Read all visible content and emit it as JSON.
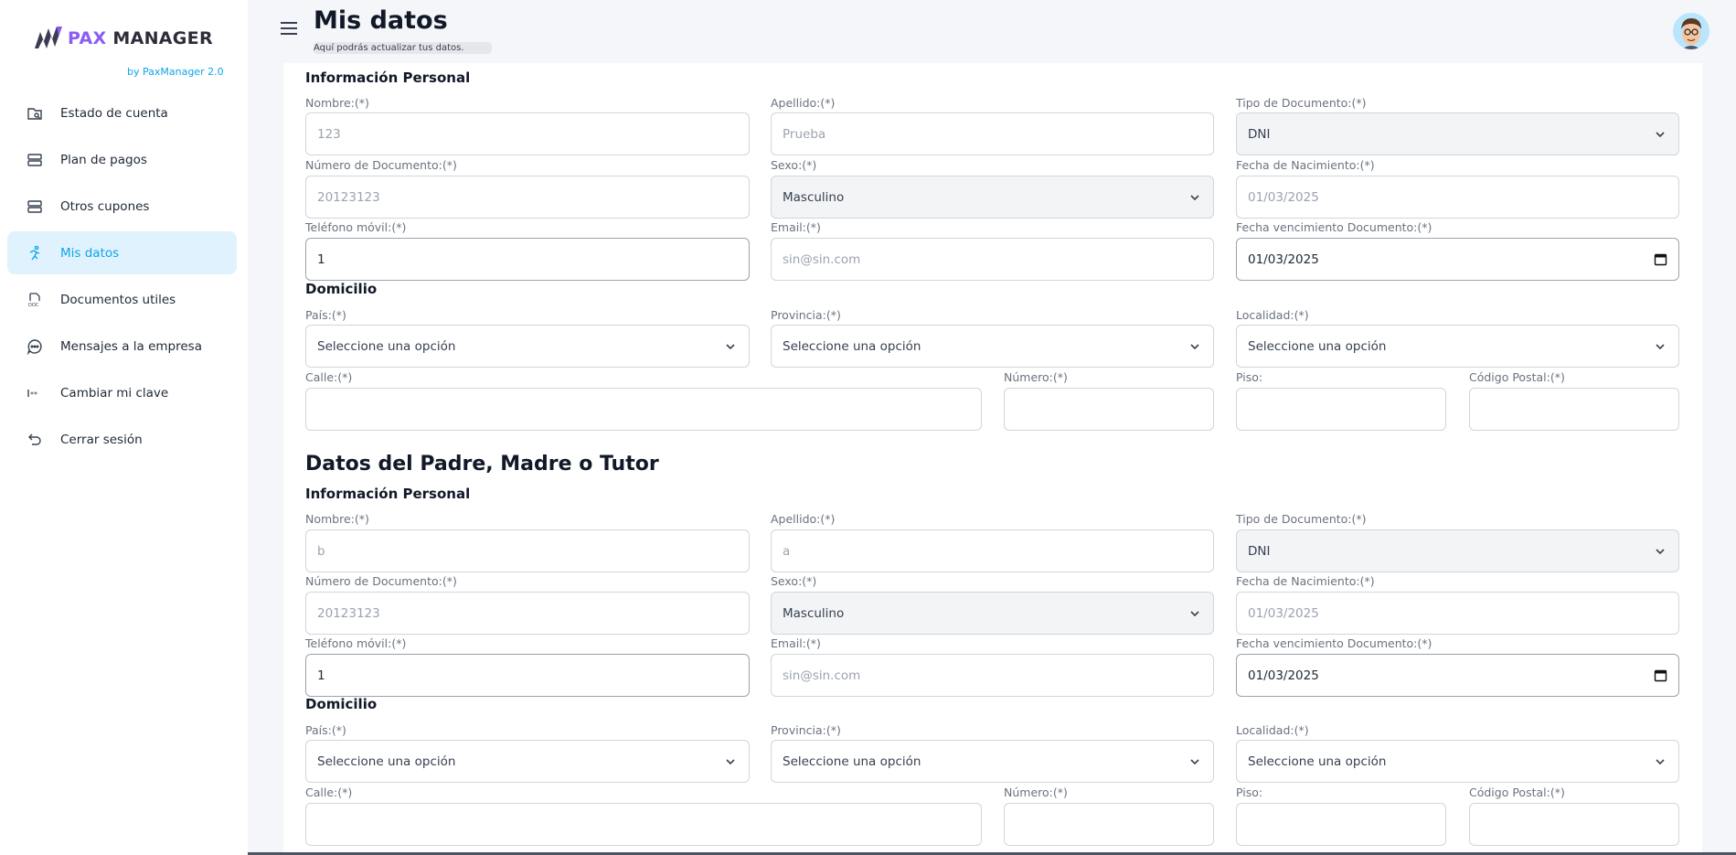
{
  "brand": {
    "pax": "PAX",
    "manager": "MANAGER",
    "sub": "by PaxManager 2.0",
    "accent_color": "#0ea5e9",
    "logo_color": "#8b5cf6"
  },
  "sidebar": {
    "items": [
      {
        "label": "Estado de cuenta",
        "icon": "account-status-icon"
      },
      {
        "label": "Plan de pagos",
        "icon": "stack-icon"
      },
      {
        "label": "Otros cupones",
        "icon": "stack-icon"
      },
      {
        "label": "Mis datos",
        "icon": "runner-icon",
        "active": true
      },
      {
        "label": "Documentos utiles",
        "icon": "doc-icon"
      },
      {
        "label": "Mensajes a la empresa",
        "icon": "chat-icon"
      },
      {
        "label": "Cambiar mi clave",
        "icon": "password-icon"
      },
      {
        "label": "Cerrar sesión",
        "icon": "logout-icon"
      }
    ]
  },
  "header": {
    "title": "Mis datos",
    "subtitle": "Aquí podrás actualizar tus datos."
  },
  "student": {
    "section_personal": "Información Personal",
    "labels": {
      "nombre": "Nombre:(*)",
      "apellido": "Apellido:(*)",
      "tipo_doc": "Tipo de Documento:(*)",
      "num_doc": "Número de Documento:(*)",
      "sexo": "Sexo:(*)",
      "fecha_nac": "Fecha de Nacimiento:(*)",
      "telefono": "Teléfono móvil:(*)",
      "email": "Email:(*)",
      "fecha_venc": "Fecha vencimiento Documento:(*)"
    },
    "values": {
      "nombre": "123",
      "apellido": "Prueba",
      "tipo_doc": "DNI",
      "num_doc": "20123123",
      "sexo": "Masculino",
      "fecha_nac": "01/03/2025",
      "telefono": "1",
      "email": "sin@sin.com",
      "fecha_venc": "01/03/2025"
    },
    "domicilio": {
      "title": "Domicilio",
      "pais_label": "País:(*)",
      "provincia_label": "Provincia:(*)",
      "localidad_label": "Localidad:(*)",
      "calle_label": "Calle:(*)",
      "numero_label": "Número:(*)",
      "piso_label": "Piso:",
      "cp_label": "Código Postal:(*)",
      "pais": "Seleccione una opción",
      "provincia": "Seleccione una opción",
      "localidad": "Seleccione una opción",
      "calle": "",
      "numero": "",
      "piso": "",
      "cp": ""
    }
  },
  "tutor": {
    "title": "Datos del Padre, Madre o Tutor",
    "section_personal": "Información Personal",
    "labels": {
      "nombre": "Nombre:(*)",
      "apellido": "Apellido:(*)",
      "tipo_doc": "Tipo de Documento:(*)",
      "num_doc": "Número de Documento:(*)",
      "sexo": "Sexo:(*)",
      "fecha_nac": "Fecha de Nacimiento:(*)",
      "telefono": "Teléfono móvil:(*)",
      "email": "Email:(*)",
      "fecha_venc": "Fecha vencimiento Documento:(*)"
    },
    "values": {
      "nombre": "b",
      "apellido": "a",
      "tipo_doc": "DNI",
      "num_doc": "20123123",
      "sexo": "Masculino",
      "fecha_nac": "01/03/2025",
      "telefono": "1",
      "email": "sin@sin.com",
      "fecha_venc": "01/03/2025"
    },
    "domicilio": {
      "title": "Domicilio",
      "pais_label": "País:(*)",
      "provincia_label": "Provincia:(*)",
      "localidad_label": "Localidad:(*)",
      "calle_label": "Calle:(*)",
      "numero_label": "Número:(*)",
      "piso_label": "Piso:",
      "cp_label": "Código Postal:(*)",
      "pais": "Seleccione una opción",
      "provincia": "Seleccione una opción",
      "localidad": "Seleccione una opción",
      "calle": "",
      "numero": "",
      "piso": "",
      "cp": ""
    }
  }
}
